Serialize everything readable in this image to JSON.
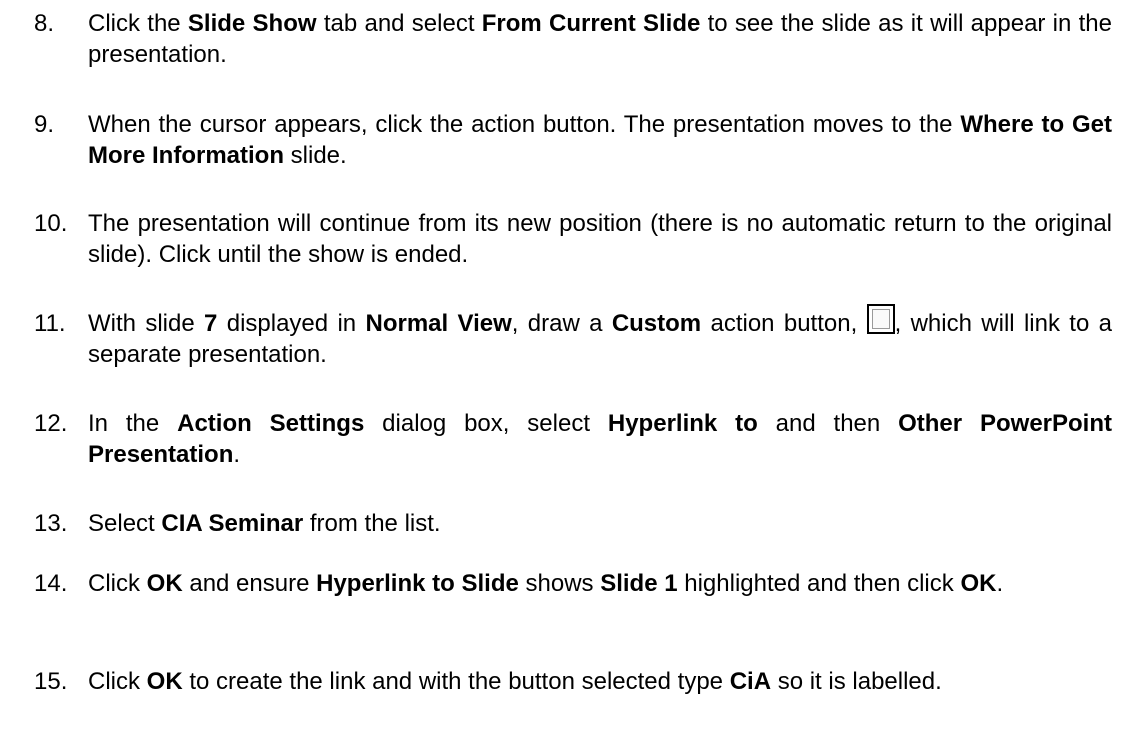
{
  "steps": [
    {
      "number": "8.",
      "parts": [
        {
          "t": "Click the "
        },
        {
          "b": "Slide Show"
        },
        {
          "t": " tab and select "
        },
        {
          "b": "From Current Slide"
        },
        {
          "t": " to see the slide as it will appear in the presentation."
        }
      ]
    },
    {
      "number": "9.",
      "parts": [
        {
          "t": "When the cursor appears, click the action button. The presentation moves to the "
        },
        {
          "b": "Where to Get More Information"
        },
        {
          "t": " slide."
        }
      ]
    },
    {
      "number": "10.",
      "parts": [
        {
          "t": "The presentation will continue from its new position (there is no automatic return to the original slide). Click until the show is ended."
        }
      ]
    },
    {
      "number": "11.",
      "parts": [
        {
          "t": "With slide "
        },
        {
          "b": "7"
        },
        {
          "t": " displayed in "
        },
        {
          "b": "Normal View"
        },
        {
          "t": ", draw a "
        },
        {
          "b": "Custom"
        },
        {
          "t": " action button, "
        },
        {
          "icon": "custom-action-button-icon"
        },
        {
          "t": ", which will link to a separate presentation."
        }
      ]
    },
    {
      "number": "12.",
      "parts": [
        {
          "t": "In the "
        },
        {
          "b": "Action Settings"
        },
        {
          "t": " dialog box, select "
        },
        {
          "b": "Hyperlink to"
        },
        {
          "t": " and then "
        },
        {
          "b": "Other PowerPoint Presentation"
        },
        {
          "t": "."
        }
      ]
    },
    {
      "number": "13.",
      "parts": [
        {
          "t": "Select "
        },
        {
          "b": "CIA Seminar"
        },
        {
          "t": " from the list."
        }
      ]
    },
    {
      "number": "14.",
      "parts": [
        {
          "t": "Click "
        },
        {
          "b": "OK"
        },
        {
          "t": " and ensure "
        },
        {
          "b": "Hyperlink to Slide"
        },
        {
          "t": " shows "
        },
        {
          "b": "Slide 1"
        },
        {
          "t": " highlighted and then click "
        },
        {
          "b": "OK"
        },
        {
          "t": "."
        }
      ]
    },
    {
      "number": "15.",
      "parts": [
        {
          "t": "Click "
        },
        {
          "b": "OK"
        },
        {
          "t": " to create the link and with the button selected type "
        },
        {
          "b": "CiA"
        },
        {
          "t": " so it is labelled."
        }
      ]
    }
  ]
}
